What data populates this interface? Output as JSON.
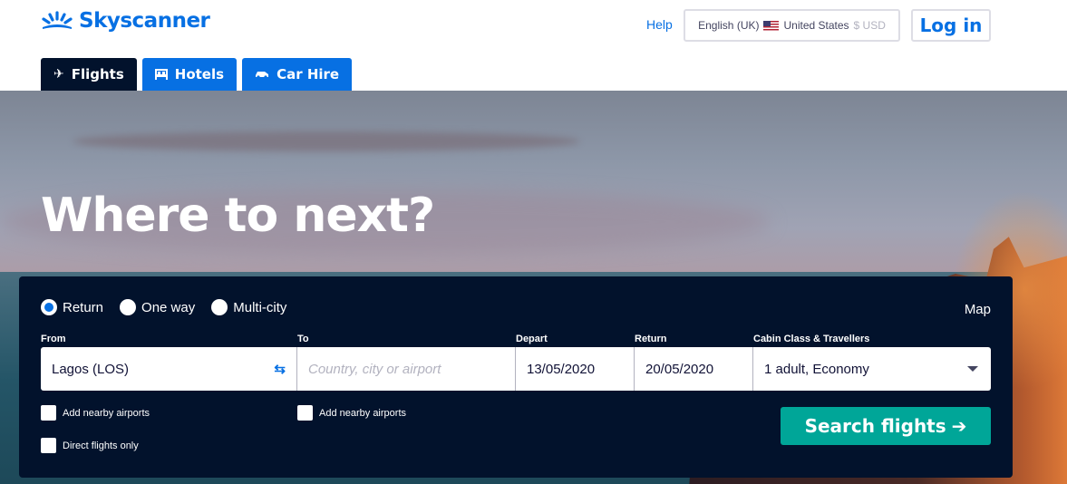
{
  "brand": {
    "name": "Skyscanner",
    "color": "#0770e3"
  },
  "header": {
    "help_label": "Help",
    "locale": {
      "language": "English (UK)",
      "country": "United States",
      "currency": "$ USD",
      "flag": "us-flag-icon"
    },
    "login_label": "Log in"
  },
  "tabs": [
    {
      "label": "Flights",
      "icon": "plane-icon",
      "active": true
    },
    {
      "label": "Hotels",
      "icon": "bed-icon",
      "active": false
    },
    {
      "label": "Car Hire",
      "icon": "car-icon",
      "active": false
    }
  ],
  "hero": {
    "title": "Where to next?"
  },
  "search": {
    "trip_types": [
      {
        "label": "Return",
        "selected": true
      },
      {
        "label": "One way",
        "selected": false
      },
      {
        "label": "Multi-city",
        "selected": false
      }
    ],
    "map_label": "Map",
    "from": {
      "label": "From",
      "value": "Lagos (LOS)"
    },
    "to": {
      "label": "To",
      "placeholder": "Country, city or airport",
      "value": ""
    },
    "depart": {
      "label": "Depart",
      "value": "13/05/2020"
    },
    "return": {
      "label": "Return",
      "value": "20/05/2020"
    },
    "cabin": {
      "label": "Cabin Class & Travellers",
      "value": "1 adult, Economy"
    },
    "checkboxes": {
      "from_nearby": {
        "label": "Add nearby airports",
        "checked": false
      },
      "to_nearby": {
        "label": "Add nearby airports",
        "checked": false
      },
      "direct_only": {
        "label": "Direct flights only",
        "checked": false
      }
    },
    "submit_label": "Search flights",
    "submit_color": "#00a698"
  }
}
